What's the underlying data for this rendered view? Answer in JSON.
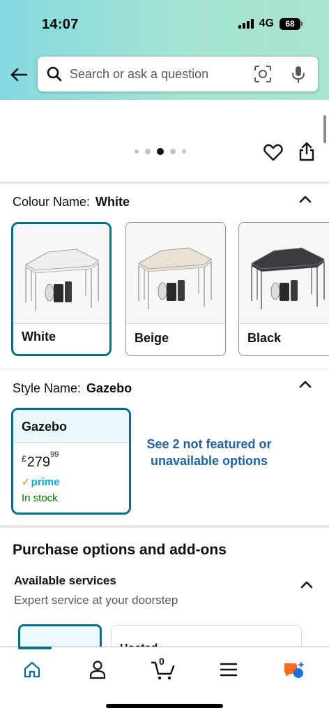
{
  "status_bar": {
    "time": "14:07",
    "network": "4G",
    "battery": "68"
  },
  "search": {
    "placeholder": "Search or ask a question"
  },
  "gallery": {
    "dot_count": 5,
    "active_dot": 2
  },
  "colour": {
    "label": "Colour Name:",
    "selected": "White",
    "options": [
      {
        "name": "White",
        "canopy_color": "#eeeeec"
      },
      {
        "name": "Beige",
        "canopy_color": "#e8e2d2"
      },
      {
        "name": "Black",
        "canopy_color": "#3a3c40"
      }
    ]
  },
  "style": {
    "label": "Style Name:",
    "selected": "Gazebo",
    "card": {
      "title": "Gazebo",
      "currency": "£",
      "price_whole": "279",
      "price_fraction": "99",
      "prime": "prime",
      "availability": "In stock"
    },
    "see_more": "See 2 not featured or unavailable options"
  },
  "purchase_options": {
    "title": "Purchase options and add-ons",
    "services_title": "Available services",
    "services_subtitle": "Expert service at your doorstep",
    "service_card_label": "Hosted"
  },
  "bottom_nav": {
    "items": [
      "home",
      "account",
      "cart",
      "menu",
      "rufus"
    ],
    "active": "home",
    "cart_count": "0"
  },
  "colors": {
    "accent": "#007185",
    "link": "#2162a1",
    "in_stock": "#007600",
    "prime": "#00a8e1"
  }
}
